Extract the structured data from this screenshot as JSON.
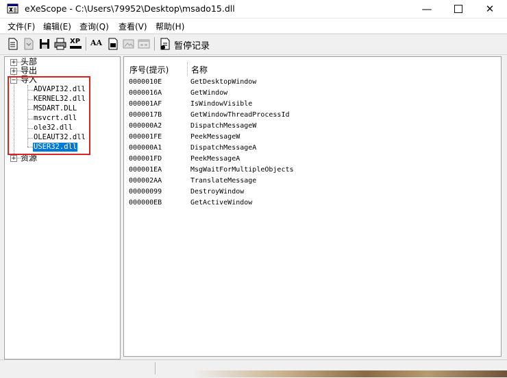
{
  "window": {
    "title": "eXeScope - C:\\Users\\79952\\Desktop\\msado15.dll",
    "minimize_glyph": "—",
    "close_glyph": "✕"
  },
  "menu": [
    {
      "label": "文件(F)"
    },
    {
      "label": "编辑(E)"
    },
    {
      "label": "查询(Q)"
    },
    {
      "label": "查看(V)"
    },
    {
      "label": "帮助(H)"
    }
  ],
  "toolbar": {
    "buttons": [
      "new-icon",
      "open-icon",
      "save-icon",
      "print-icon",
      "xp-icon",
      "font-icon",
      "resource-icon",
      "image-icon",
      "dialog-icon"
    ],
    "xp_text": "XP",
    "font_text": "AA",
    "pause_label": "暂停记录"
  },
  "tree": {
    "nodes": [
      {
        "label": "头部",
        "expander": "+"
      },
      {
        "label": "导出",
        "expander": "+"
      },
      {
        "label": "导入",
        "expander": "−"
      },
      {
        "label": "资源",
        "expander": "+"
      }
    ],
    "imports": [
      "ADVAPI32.dll",
      "KERNEL32.dll",
      "MSDART.DLL",
      "msvcrt.dll",
      "ole32.dll",
      "OLEAUT32.dll",
      "USER32.dll"
    ],
    "selected": "USER32.dll"
  },
  "list": {
    "columns": [
      "序号(提示)",
      "名称"
    ],
    "rows": [
      {
        "ordinal": "0000010E",
        "name": "GetDesktopWindow"
      },
      {
        "ordinal": "0000016A",
        "name": "GetWindow"
      },
      {
        "ordinal": "000001AF",
        "name": "IsWindowVisible"
      },
      {
        "ordinal": "0000017B",
        "name": "GetWindowThreadProcessId"
      },
      {
        "ordinal": "000000A2",
        "name": "DispatchMessageW"
      },
      {
        "ordinal": "000001FE",
        "name": "PeekMessageW"
      },
      {
        "ordinal": "000000A1",
        "name": "DispatchMessageA"
      },
      {
        "ordinal": "000001FD",
        "name": "PeekMessageA"
      },
      {
        "ordinal": "000001EA",
        "name": "MsgWaitForMultipleObjects"
      },
      {
        "ordinal": "000002AA",
        "name": "TranslateMessage"
      },
      {
        "ordinal": "00000099",
        "name": "DestroyWindow"
      },
      {
        "ordinal": "000000EB",
        "name": "GetActiveWindow"
      }
    ]
  },
  "colors": {
    "selection": "#0078d7",
    "highlight_box": "#e02020"
  }
}
